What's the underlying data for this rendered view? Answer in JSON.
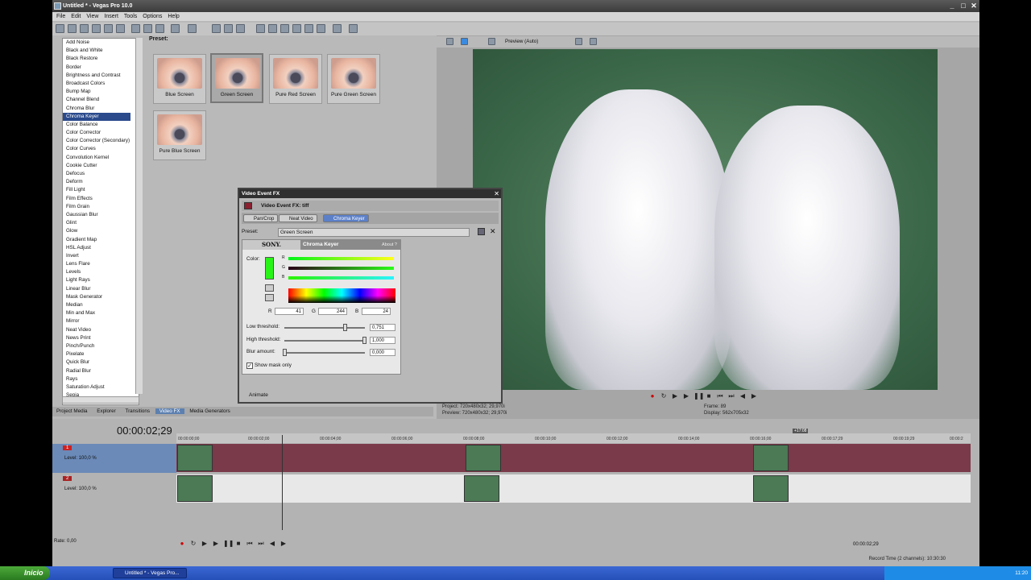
{
  "window": {
    "title": "Untitled * - Vegas Pro 10.0",
    "controls": [
      "_",
      "□",
      "✕"
    ]
  },
  "menu": [
    "File",
    "Edit",
    "View",
    "Insert",
    "Tools",
    "Options",
    "Help"
  ],
  "fx_list": {
    "items": [
      "Add Noise",
      "Black and White",
      "Black Restore",
      "Border",
      "Brightness and Contrast",
      "Broadcast Colors",
      "Bump Map",
      "Channel Blend",
      "Chroma Blur",
      "Chroma Keyer",
      "Color Balance",
      "Color Corrector",
      "Color Corrector (Secondary)",
      "Color Curves",
      "Convolution Kernel",
      "Cookie Cutter",
      "Defocus",
      "Deform",
      "Fill Light",
      "Film Effects",
      "Film Grain",
      "Gaussian Blur",
      "Glint",
      "Glow",
      "Gradient Map",
      "HSL Adjust",
      "Invert",
      "Lens Flare",
      "Levels",
      "Light Rays",
      "Linear Blur",
      "Mask Generator",
      "Median",
      "Min and Max",
      "Mirror",
      "Neat Video",
      "News Print",
      "Pinch/Punch",
      "Pixelate",
      "Quick Blur",
      "Radial Blur",
      "Rays",
      "Saturation Adjust",
      "Sepia"
    ],
    "selected": "Chroma Keyer"
  },
  "presets": {
    "label": "Preset:",
    "items": [
      "Blue Screen",
      "Green Screen",
      "Pure Red Screen",
      "Pure Green Screen",
      "Pure Blue Screen"
    ],
    "selected": "Green Screen"
  },
  "bottom_tabs": [
    "Project Media",
    "Explorer",
    "Transitions",
    "Video FX",
    "Media Generators"
  ],
  "active_tab": "Video FX",
  "preview": {
    "mode": "Preview (Auto)",
    "project": "Project: 720x480x32; 29,970i",
    "preview_line": "Preview: 720x480x32; 29,970i",
    "frame": "Frame: 89",
    "display": "Display: 562x705x32"
  },
  "dialog": {
    "title": "Video Event FX",
    "header": "Video Event FX:  tiff",
    "chain": [
      "Pan/Crop",
      "Neat Video",
      "Chroma Keyer"
    ],
    "preset_label": "Preset:",
    "preset_value": "Green Screen",
    "sony": "SONY.",
    "plugin_name": "Chroma Keyer",
    "about": "About ?",
    "color_label": "Color:",
    "channel_letters": [
      "R",
      "G",
      "B"
    ],
    "rgb": {
      "R": "41",
      "G": "244",
      "B": "24"
    },
    "low_threshold_label": "Low threshold:",
    "low_threshold": "0,751",
    "high_threshold_label": "High threshold:",
    "high_threshold": "1,000",
    "blur_label": "Blur amount:",
    "blur": "0,000",
    "show_mask_label": "Show mask only",
    "show_mask": true,
    "animate": "Animate",
    "key_color": "#29f418"
  },
  "timeline": {
    "time": "00:00:02;29",
    "ruler": [
      "00:00:00;00",
      "00:00:02;00",
      "00:00:04;00",
      "00:00:06;00",
      "00:00:08;00",
      "00:00:10;00",
      "00:00:12;00",
      "00:00:14;00",
      "00:00:16;00",
      "00:00:17;29",
      "00:00:19;29",
      "00:00:2"
    ],
    "marker": "+17:08",
    "tracks": [
      {
        "num": "1",
        "level": "Level: 100,0 %"
      },
      {
        "num": "2",
        "level": "Level: 100,0 %"
      }
    ],
    "rate": "Rate: 0,00",
    "end_time": "00:00:02;29",
    "record_time": "Record Time (2 channels): 10:30:30"
  },
  "taskbar": {
    "start": "Inicio",
    "task": "Untitled * - Vegas Pro...",
    "clock": "11:20"
  },
  "colors": {
    "selected_blue": "#2a4a8c",
    "track1": "#7a3a4a",
    "video_bg": "#3a6648"
  }
}
